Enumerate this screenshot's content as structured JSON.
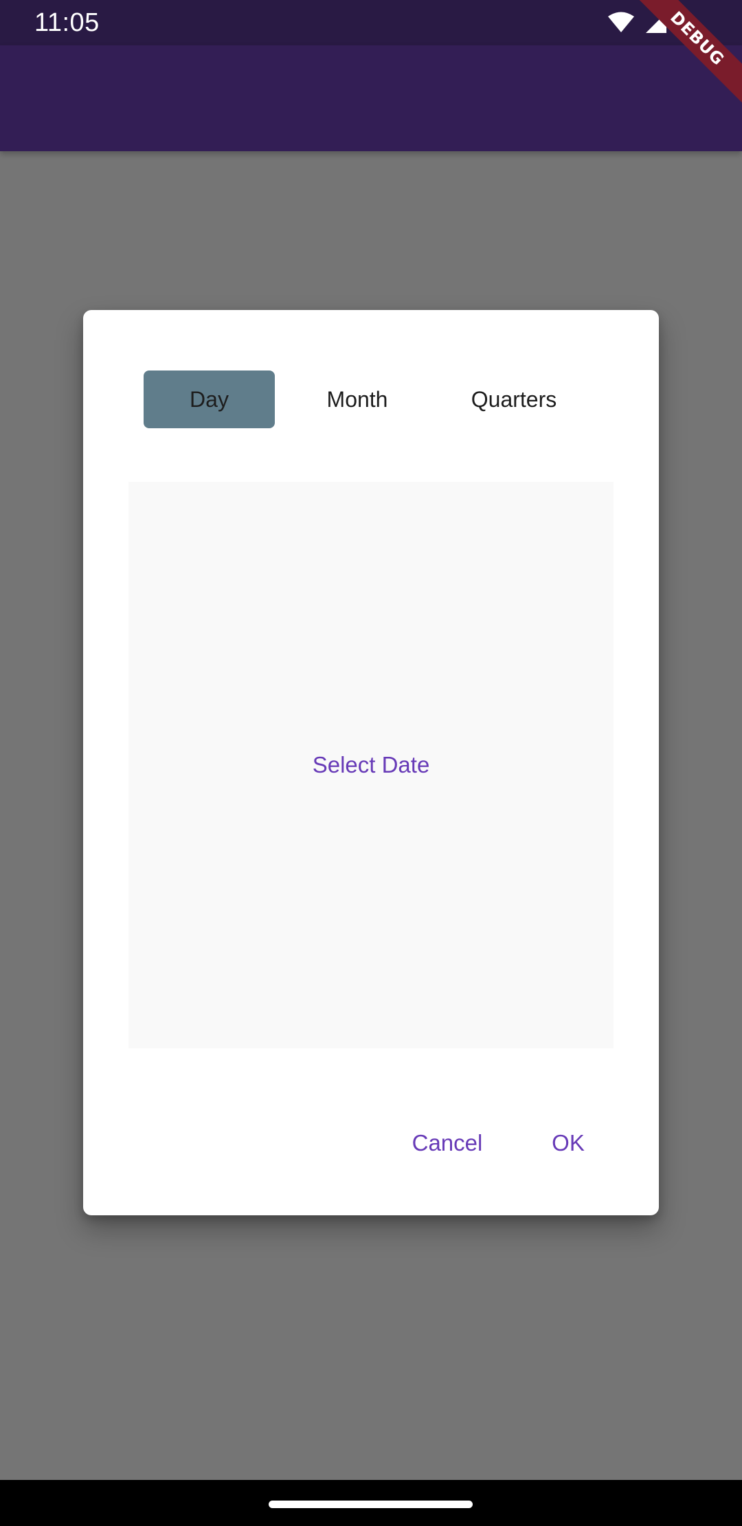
{
  "status_bar": {
    "time": "11:05",
    "icons": [
      "wifi-icon",
      "cellular-signal-icon",
      "battery-icon"
    ]
  },
  "debug_banner": {
    "label": "DEBUG"
  },
  "dialog": {
    "tabs": [
      {
        "label": "Day",
        "selected": true
      },
      {
        "label": "Month",
        "selected": false
      },
      {
        "label": "Quarters",
        "selected": false
      }
    ],
    "picker_prompt": "Select Date",
    "actions": {
      "cancel_label": "Cancel",
      "ok_label": "OK"
    }
  },
  "colors": {
    "status_bar": "#291a44",
    "app_bar": "#331e55",
    "scrim_background": "#757575",
    "selected_tab": "#607d8b",
    "accent": "#673ab7",
    "debug_ribbon": "#7a1c2b"
  }
}
